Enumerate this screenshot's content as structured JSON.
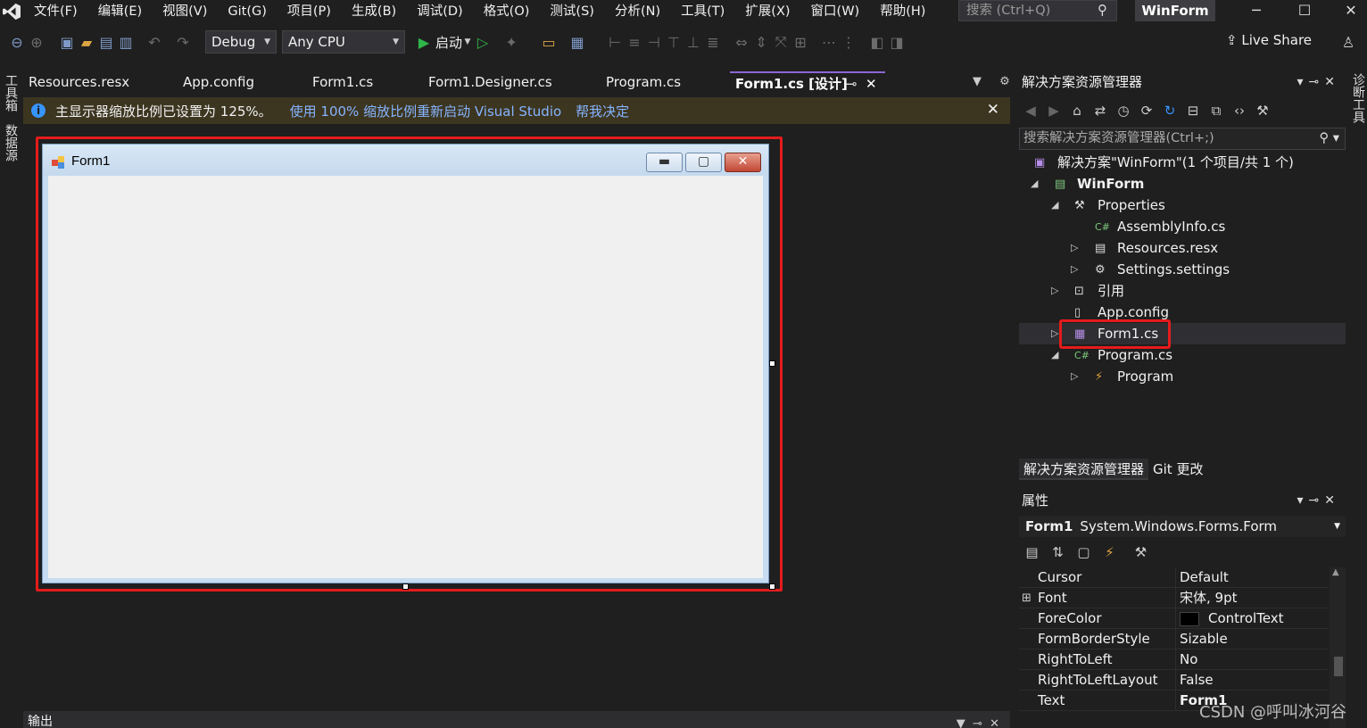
{
  "menubar": {
    "items": [
      "文件(F)",
      "编辑(E)",
      "视图(V)",
      "Git(G)",
      "项目(P)",
      "生成(B)",
      "调试(D)",
      "格式(O)",
      "测试(S)",
      "分析(N)",
      "工具(T)",
      "扩展(X)",
      "窗口(W)",
      "帮助(H)"
    ],
    "search_placeholder": "搜索 (Ctrl+Q)",
    "project_name": "WinForm"
  },
  "toolbar": {
    "config": "Debug",
    "platform": "Any CPU",
    "start_label": "启动",
    "live_share": "Live Share"
  },
  "left_strip": {
    "toolbox": "工具箱",
    "datasource": "数据源"
  },
  "right_strip": {
    "diagnostics": "诊断工具"
  },
  "doc_tabs": [
    {
      "label": "Resources.resx"
    },
    {
      "label": "App.config"
    },
    {
      "label": "Form1.cs"
    },
    {
      "label": "Form1.Designer.cs"
    },
    {
      "label": "Program.cs"
    },
    {
      "label": "Form1.cs [设计]",
      "active": true
    }
  ],
  "infobar": {
    "message": "主显示器缩放比例已设置为 125%。",
    "link_restart": "使用 100% 缩放比例重新启动 Visual Studio",
    "link_decide": "帮我决定"
  },
  "designer": {
    "form_title": "Form1"
  },
  "output": {
    "title": "输出"
  },
  "solution_explorer": {
    "title": "解决方案资源管理器",
    "search_placeholder": "搜索解决方案资源管理器(Ctrl+;)",
    "tree": [
      {
        "label": "解决方案\"WinForm\"(1 个项目/共 1 个)",
        "icon": "solution-icon"
      },
      {
        "label": "WinForm",
        "icon": "csharp-project-icon"
      },
      {
        "label": "Properties",
        "icon": "wrench-icon"
      },
      {
        "label": "AssemblyInfo.cs",
        "icon": "csharp-file-icon"
      },
      {
        "label": "Resources.resx",
        "icon": "resx-icon"
      },
      {
        "label": "Settings.settings",
        "icon": "settings-gear-icon"
      },
      {
        "label": "引用",
        "icon": "references-icon"
      },
      {
        "label": "App.config",
        "icon": "config-file-icon"
      },
      {
        "label": "Form1.cs",
        "icon": "form-icon",
        "selected": true
      },
      {
        "label": "Program.cs",
        "icon": "csharp-file-icon"
      },
      {
        "label": "Program",
        "icon": "class-icon"
      }
    ],
    "tabs": [
      "解决方案资源管理器",
      "Git 更改"
    ]
  },
  "properties": {
    "title": "属性",
    "object_name": "Form1",
    "object_type": "System.Windows.Forms.Form",
    "rows": [
      {
        "name": "Cursor",
        "value": "Default"
      },
      {
        "name": "Font",
        "value": "宋体, 9pt",
        "expandable": true
      },
      {
        "name": "ForeColor",
        "value": "ControlText",
        "swatch": "#000000"
      },
      {
        "name": "FormBorderStyle",
        "value": "Sizable"
      },
      {
        "name": "RightToLeft",
        "value": "No"
      },
      {
        "name": "RightToLeftLayout",
        "value": "False"
      },
      {
        "name": "Text",
        "value": "Form1",
        "bold": true
      }
    ]
  },
  "watermark": "CSDN @呼叫冰河谷",
  "colors": {
    "accent": "#8b67d3",
    "highlight_red": "#e51b1b",
    "infobar_bg": "#3c3520",
    "link": "#86b4ff"
  }
}
